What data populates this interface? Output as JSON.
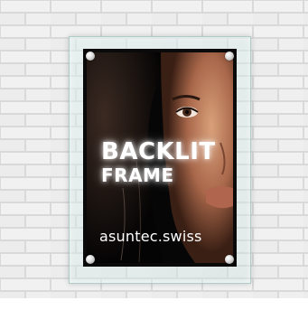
{
  "poster": {
    "headline_line1": "BACKLIT",
    "headline_line2": "FRAME",
    "brand": "asuntec.swiss"
  },
  "colors": {
    "wall": "#eeeeee",
    "mortar": "#d8d8d8",
    "frame_glass": "#d7ece8",
    "poster_background": "#070707",
    "headline_text": "#ffffff"
  }
}
